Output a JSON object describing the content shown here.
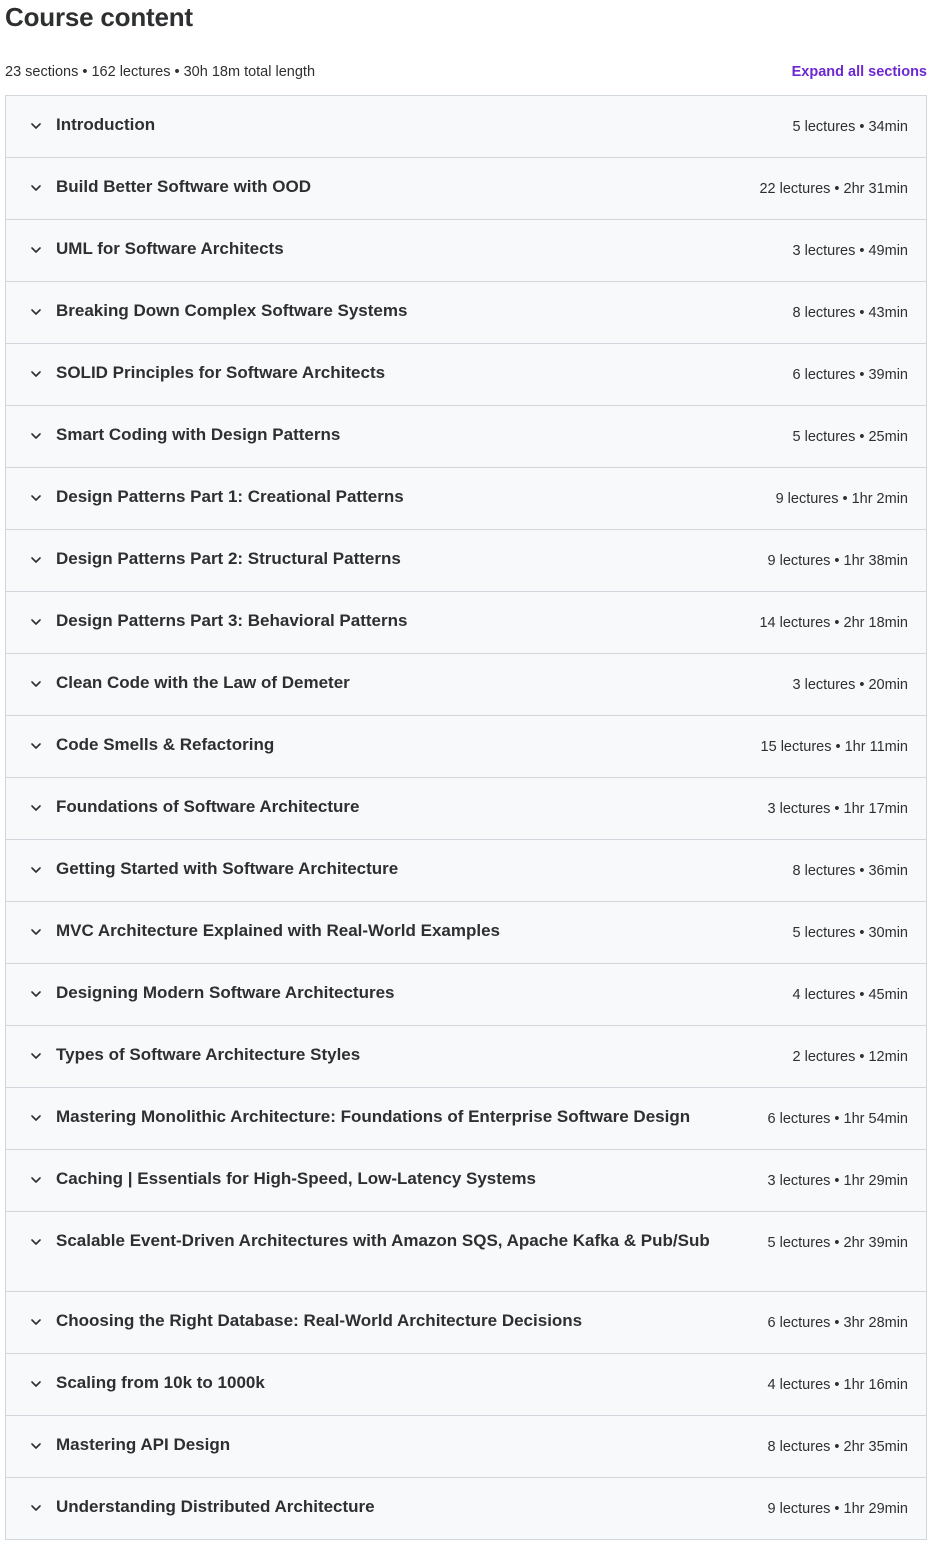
{
  "header": {
    "title": "Course content",
    "summary": "23 sections • 162 lectures • 30h 18m total length",
    "expand_all_label": "Expand all sections"
  },
  "sections": [
    {
      "title": "Introduction",
      "meta": "5 lectures • 34min"
    },
    {
      "title": "Build Better Software with OOD",
      "meta": "22 lectures • 2hr 31min"
    },
    {
      "title": "UML for Software Architects",
      "meta": "3 lectures • 49min"
    },
    {
      "title": "Breaking Down Complex Software Systems",
      "meta": "8 lectures • 43min"
    },
    {
      "title": "SOLID Principles for Software Architects",
      "meta": "6 lectures • 39min"
    },
    {
      "title": "Smart Coding with Design Patterns",
      "meta": "5 lectures • 25min"
    },
    {
      "title": "Design Patterns Part 1: Creational Patterns",
      "meta": "9 lectures • 1hr 2min"
    },
    {
      "title": "Design Patterns Part 2: Structural Patterns",
      "meta": "9 lectures • 1hr 38min"
    },
    {
      "title": "Design Patterns Part 3: Behavioral Patterns",
      "meta": "14 lectures • 2hr 18min"
    },
    {
      "title": "Clean Code with the Law of Demeter",
      "meta": "3 lectures • 20min"
    },
    {
      "title": "Code Smells & Refactoring",
      "meta": "15 lectures • 1hr 11min"
    },
    {
      "title": "Foundations of Software Architecture",
      "meta": "3 lectures • 1hr 17min"
    },
    {
      "title": "Getting Started with Software Architecture",
      "meta": "8 lectures • 36min"
    },
    {
      "title": "MVC Architecture Explained with Real-World Examples",
      "meta": "5 lectures • 30min"
    },
    {
      "title": "Designing Modern Software Architectures",
      "meta": "4 lectures • 45min"
    },
    {
      "title": "Types of Software Architecture Styles",
      "meta": "2 lectures • 12min"
    },
    {
      "title": "Mastering Monolithic Architecture: Foundations of Enterprise Software Design",
      "meta": "6 lectures • 1hr 54min"
    },
    {
      "title": "Caching | Essentials for High-Speed, Low-Latency Systems",
      "meta": "3 lectures • 1hr 29min"
    },
    {
      "title": "Scalable Event-Driven Architectures with Amazon SQS, Apache Kafka & Pub/Sub",
      "meta": "5 lectures • 2hr 39min"
    },
    {
      "title": "Choosing the Right Database: Real-World Architecture Decisions",
      "meta": "6 lectures • 3hr 28min"
    },
    {
      "title": "Scaling from 10k to 1000k",
      "meta": "4 lectures • 1hr 16min"
    },
    {
      "title": "Mastering API Design",
      "meta": "8 lectures • 2hr 35min"
    },
    {
      "title": "Understanding Distributed Architecture",
      "meta": "9 lectures • 1hr 29min"
    }
  ],
  "colors": {
    "accent": "#6d28d2",
    "row_background": "#f7f9fa",
    "border": "#d1d7dc",
    "text": "#2d2f31"
  },
  "icons": {
    "section_toggle": "chevron-down-icon"
  }
}
